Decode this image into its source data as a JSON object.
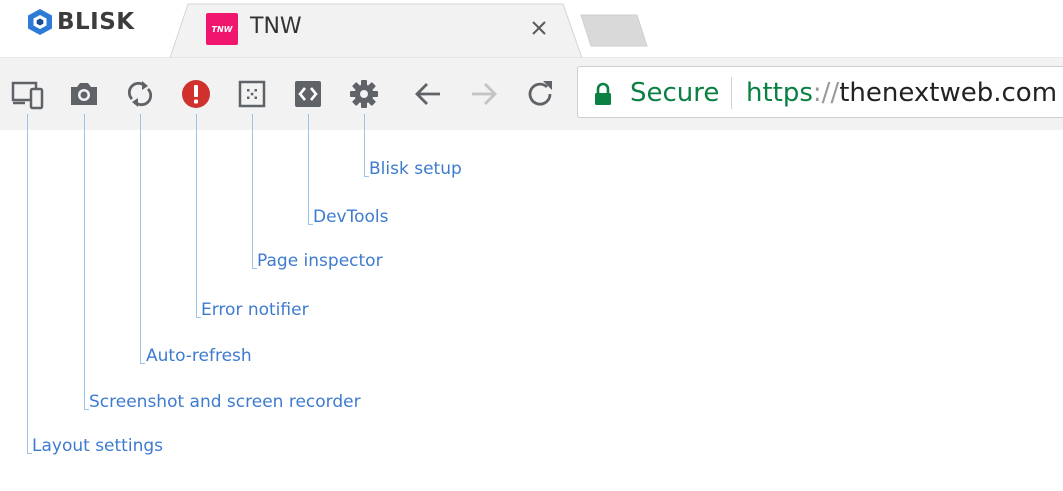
{
  "browser": {
    "logo_text": "BLISK"
  },
  "tab": {
    "title": "TNW",
    "favicon_text": "TNW",
    "favicon_color": "#f0166d"
  },
  "toolbar": {
    "icons": [
      {
        "name": "layout-settings-icon"
      },
      {
        "name": "camera-icon"
      },
      {
        "name": "refresh-cycle-icon"
      },
      {
        "name": "error-icon",
        "color": "#d0312d"
      },
      {
        "name": "page-inspector-icon"
      },
      {
        "name": "devtools-icon"
      },
      {
        "name": "gear-icon"
      },
      {
        "name": "back-arrow-icon"
      },
      {
        "name": "forward-arrow-icon"
      },
      {
        "name": "reload-icon"
      }
    ]
  },
  "address_bar": {
    "secure_label": "Secure",
    "url_scheme": "https",
    "url_separator": "://",
    "url_host": "thenextweb.com",
    "secure_color": "#0b8043"
  },
  "callouts": {
    "layout": "Layout settings",
    "screenshot": "Screenshot and screen recorder",
    "autorefresh": "Auto-refresh",
    "error": "Error notifier",
    "inspector": "Page inspector",
    "devtools": "DevTools",
    "setup": "Blisk setup"
  },
  "colors": {
    "callout_text": "#3d7bd0",
    "callout_line": "#9fc2ea",
    "toolbar_bg": "#f2f2f2"
  }
}
